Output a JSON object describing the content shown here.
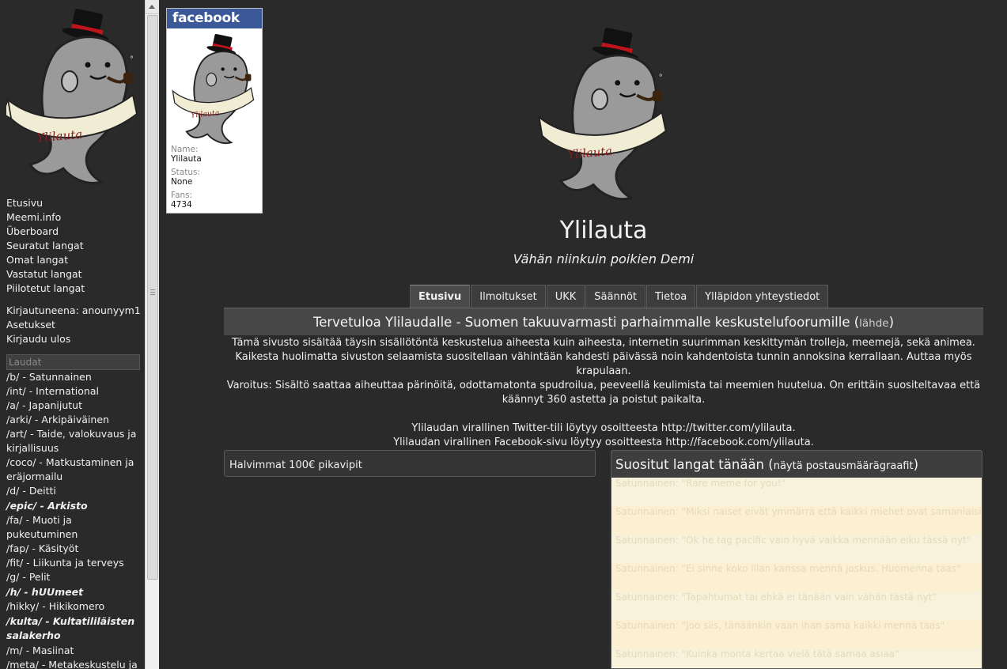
{
  "sidebar": {
    "nav": [
      "Etusivu",
      "Meemi.info",
      "Überboard",
      "Seuratut langat",
      "Omat langat",
      "Vastatut langat",
      "Piilotetut langat"
    ],
    "account": [
      "Kirjautuneena: anounyym1",
      "Asetukset",
      "Kirjaudu ulos"
    ],
    "boards_header": "Laudat",
    "boards": [
      {
        "label": "/b/ - Satunnainen"
      },
      {
        "label": "/int/ - International"
      },
      {
        "label": "/a/ - Japanijutut"
      },
      {
        "label": "/arki/ - Arkipäiväinen"
      },
      {
        "label": "/art/ - Taide, valokuvaus ja kirjallisuus"
      },
      {
        "label": "/coco/ - Matkustaminen ja eräjormailu"
      },
      {
        "label": "/d/ - Deitti"
      },
      {
        "label": "/epic/ - Arkisto",
        "bold": true
      },
      {
        "label": "/fa/ - Muoti ja pukeutuminen"
      },
      {
        "label": "/fap/ - Käsityöt"
      },
      {
        "label": "/fit/ - Liikunta ja terveys"
      },
      {
        "label": "/g/ - Pelit"
      },
      {
        "label": "/h/ - hUUmeet",
        "bold": true
      },
      {
        "label": "/hikky/ - Hikikomero"
      },
      {
        "label": "/kulta/ - Kultatililäisten salakerho",
        "bold": true
      },
      {
        "label": "/m/ - Masiinat"
      },
      {
        "label": "/meta/ - Metakeskustelu ja"
      }
    ]
  },
  "facebook": {
    "header": "facebook",
    "name_label": "Name:",
    "name": "Ylilauta",
    "status_label": "Status:",
    "status": "None",
    "fans_label": "Fans:",
    "fans": "4734"
  },
  "site": {
    "title": "Ylilauta",
    "subtitle": "Vähän niinkuin poikien Demi"
  },
  "tabs": [
    "Etusivu",
    "Ilmoitukset",
    "UKK",
    "Säännöt",
    "Tietoa",
    "Ylläpidon yhteystiedot"
  ],
  "welcome": {
    "heading": "Tervetuloa Ylilaudalle - Suomen takuuvarmasti parhaimmalle keskustelufoorumille (",
    "source_link": "lähde",
    "heading_end": ")",
    "paragraphs": [
      "Tämä sivusto sisältää täysin sisällötöntä keskustelua aiheesta kuin aiheesta, internetin suurimman keskittymän trolleja, meemejä, sekä animea. Kaikesta huolimatta sivuston selaamista suositellaan vähintään kahdesti päivässä noin kahdentoista tunnin annoksina kerrallaan. Auttaa myös krapulaan.",
      "Varoitus: Sisältö saattaa aiheuttaa pärinöitä, odottamatonta spudroilua, peeveellä keulimista tai meemien huutelua. On erittäin suositeltavaa että käännyt 360 astetta ja poistut paikalta."
    ],
    "links": [
      "Ylilaudan virallinen Twitter-tili löytyy osoitteesta http://twitter.com/ylilauta.",
      "Ylilaudan virallinen Facebook-sivu löytyy osoitteesta http://facebook.com/ylilauta."
    ]
  },
  "ad_box": "Halvimmat 100€ pikavipit",
  "popular": {
    "title": "Suositut langat tänään (",
    "graph_link": "näytä postausmäärägraafit",
    "title_end": ")",
    "threads": [
      "Satunnainen: \"Rare meme for you!\"",
      "Satunnainen: \"Miksi naiset eivät ymmärrä että kaikki miehet ovat samanlaisia\"",
      "Satunnainen: \"Ok he tag pacific vain hyvä vaikka mennään eiku tässä nyt\"",
      "Satunnainen: \"Ei sinne koko illan kanssa mennä joskus. Huomenna taas\"",
      "Satunnainen: \"Tapahtumat tai ehkä ei tänään vain vähän tästä nyt\"",
      "Satunnainen: \"Joo siis, tänäänkin vaan ihan sama kaikki mennä taas\"",
      "Satunnainen: \"Kuinka monta kertaa vielä tätä samaa asiaa\""
    ]
  },
  "colors": {
    "background": "#2a2a2a",
    "facebook_blue": "#3b5998",
    "popular_bg": "#fbf5dc"
  }
}
